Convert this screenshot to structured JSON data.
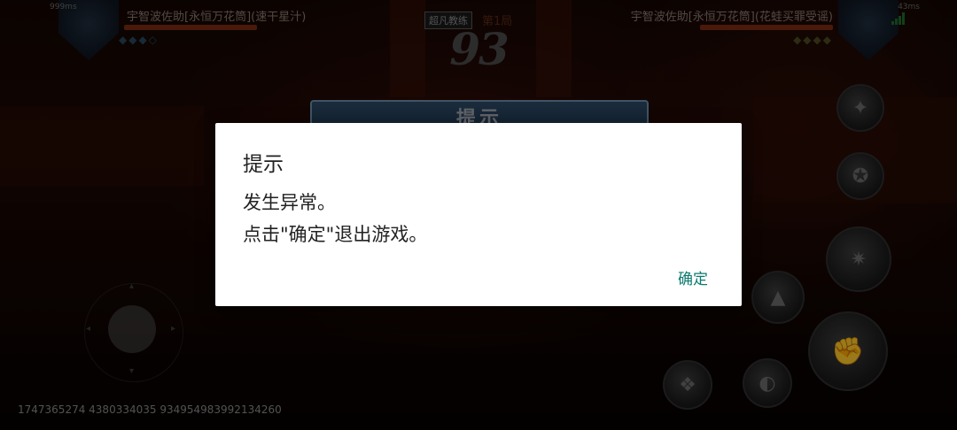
{
  "hud": {
    "player_left": {
      "ping": "999ms",
      "name": "宇智波佐助[永恒万花筒](速干星汁)"
    },
    "player_right": {
      "ping": "43ms",
      "name": "宇智波佐助[永恒万花筒](花蛙买罪受谣)"
    },
    "mode_label": "超凡教练",
    "round_label": "第1局",
    "timer": "93",
    "ingame_tip_title": "提示"
  },
  "build_id": "1747365274 4380334035 934954983992134260",
  "dialog": {
    "title": "提示",
    "message_lines": [
      "发生异常。",
      "点击\"确定\"退出游戏。"
    ],
    "confirm_label": "确定"
  },
  "colors": {
    "accent": "#0c7a6e",
    "dialog_bg": "#ffffff"
  }
}
